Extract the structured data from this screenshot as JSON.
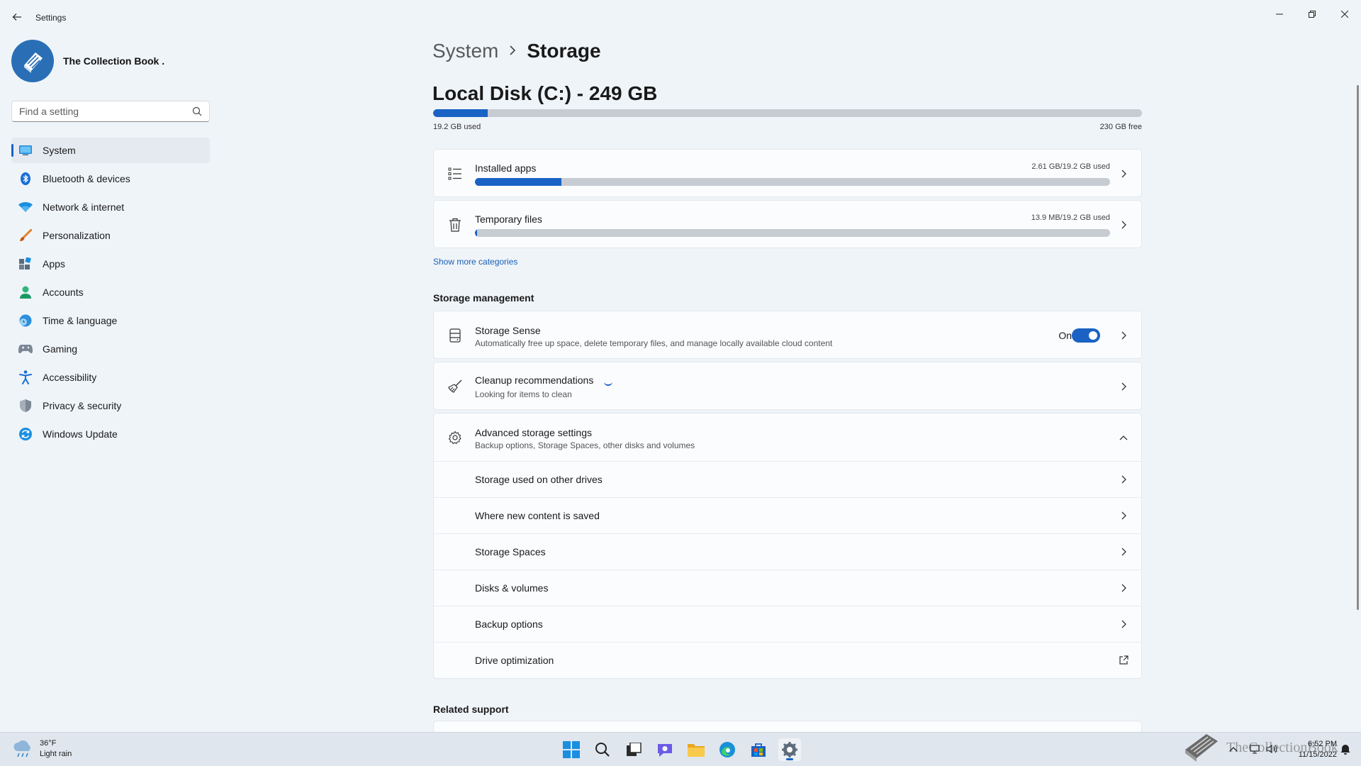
{
  "window": {
    "title": "Settings"
  },
  "profile": {
    "name": "The Collection Book ."
  },
  "search": {
    "placeholder": "Find a setting"
  },
  "sidebar": {
    "items": [
      {
        "label": "System"
      },
      {
        "label": "Bluetooth & devices"
      },
      {
        "label": "Network & internet"
      },
      {
        "label": "Personalization"
      },
      {
        "label": "Apps"
      },
      {
        "label": "Accounts"
      },
      {
        "label": "Time & language"
      },
      {
        "label": "Gaming"
      },
      {
        "label": "Accessibility"
      },
      {
        "label": "Privacy & security"
      },
      {
        "label": "Windows Update"
      }
    ]
  },
  "breadcrumb": {
    "parent": "System",
    "current": "Storage"
  },
  "disk": {
    "title": "Local Disk (C:) - 249 GB",
    "used_label": "19.2 GB used",
    "free_label": "230 GB free",
    "used_fraction": 0.077
  },
  "categories": [
    {
      "title": "Installed apps",
      "usage": "2.61 GB/19.2 GB used",
      "fraction": 0.136
    },
    {
      "title": "Temporary files",
      "usage": "13.9 MB/19.2 GB used",
      "fraction": 0.002
    }
  ],
  "show_more": "Show more categories",
  "storage_management": {
    "title": "Storage management",
    "storage_sense": {
      "title": "Storage Sense",
      "description": "Automatically free up space, delete temporary files, and manage locally available cloud content",
      "toggle_label": "On"
    },
    "cleanup": {
      "title": "Cleanup recommendations",
      "description": "Looking for items to clean"
    },
    "advanced": {
      "title": "Advanced storage settings",
      "description": "Backup options, Storage Spaces, other disks and volumes"
    },
    "advanced_items": [
      {
        "label": "Storage used on other drives"
      },
      {
        "label": "Where new content is saved"
      },
      {
        "label": "Storage Spaces"
      },
      {
        "label": "Disks & volumes"
      },
      {
        "label": "Backup options"
      },
      {
        "label": "Drive optimization"
      }
    ]
  },
  "related_support": {
    "title": "Related support"
  },
  "taskbar": {
    "weather": {
      "temp": "36°F",
      "condition": "Light rain"
    },
    "clock": {
      "time": "6:52 PM",
      "date": "11/15/2022"
    },
    "watermark": "TheCollectionBook"
  },
  "colors": {
    "accent": "#1a62c4",
    "bar_track": "#c7ccd2"
  }
}
